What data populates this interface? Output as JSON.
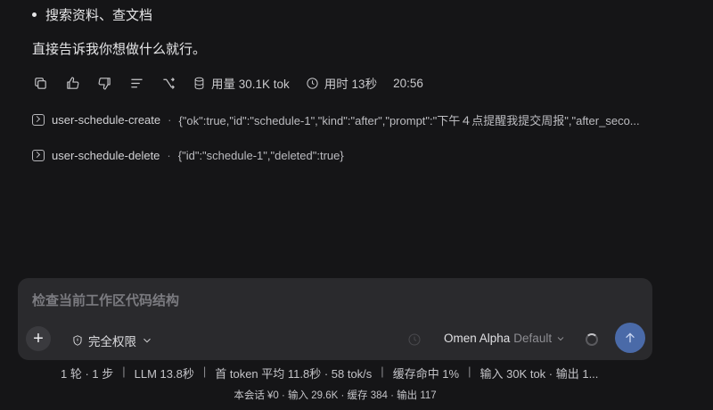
{
  "message": {
    "bullet_text": "搜索资料、查文档",
    "reply_text": "直接告诉我你想做什么就行。"
  },
  "actions": {
    "icons": [
      "copy-icon",
      "thumbs-up-icon",
      "thumbs-down-icon",
      "list-icon",
      "branch-icon"
    ],
    "usage_label": "用量 30.1K tok",
    "duration_label": "用时 13秒",
    "time": "20:56"
  },
  "tool_calls": [
    {
      "name": "user-schedule-create",
      "separator": "·",
      "result": "{\"ok\":true,\"id\":\"schedule-1\",\"kind\":\"after\",\"prompt\":\"下午４点提醒我提交周报\",\"after_seco..."
    },
    {
      "name": "user-schedule-delete",
      "separator": "·",
      "result": "{\"id\":\"schedule-1\",\"deleted\":true}"
    }
  ],
  "composer": {
    "placeholder": "检查当前工作区代码结构",
    "value": "",
    "permission_label": "完全权限",
    "model_name": "Omen Alpha",
    "model_variant": "Default",
    "accent_color": "#4a6aa8"
  },
  "stats": {
    "items": [
      "1 轮 · 1 步",
      "LLM 13.8秒",
      "首 token 平均 11.8秒 · 58 tok/s",
      "缓存命中 1%",
      "输入 30K tok · 输出 1..."
    ],
    "separator": "|",
    "session_line": "本会话 ¥0 · 输入 29.6K · 缓存 384 · 输出 117"
  }
}
